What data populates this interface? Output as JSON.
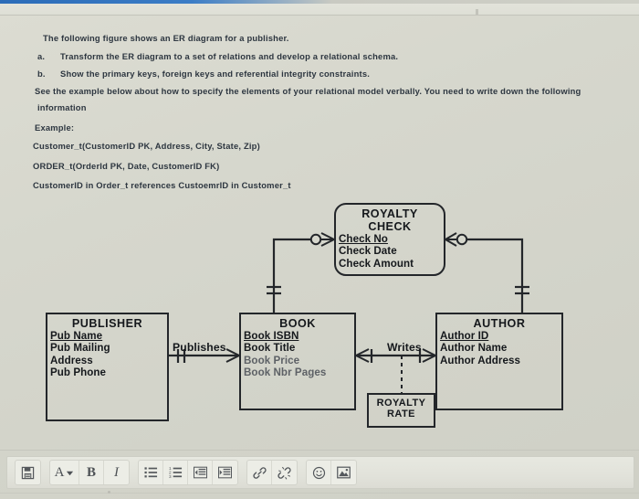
{
  "document": {
    "intro": "The following figure shows an ER diagram for a publisher.",
    "item_a_marker": "a.",
    "item_a_text": "Transform the ER diagram to a set of relations and develop a relational schema.",
    "item_b_marker": "b.",
    "item_b_text": "Show the primary keys, foreign keys and referential integrity constraints.",
    "see_example_line": "See the example below about how to specify the elements of your relational model verbally. You need to write down the following",
    "information_line": "information",
    "example_label": "Example:",
    "example_customer": "Customer_t(CustomerID PK, Address, City, State, Zip)",
    "example_order": "ORDER_t(OrderId PK, Date, CustomerID FK)",
    "example_reference": "CustomerID in Order_t references CustoemrID in Customer_t"
  },
  "diagram": {
    "entities": {
      "royalty_check": {
        "title_line1": "ROYALTY",
        "title_line2": "CHECK",
        "attributes": [
          {
            "label": "Check No",
            "pk": true
          },
          {
            "label": "Check Date",
            "pk": false
          },
          {
            "label": "Check Amount",
            "pk": false
          }
        ]
      },
      "publisher": {
        "title": "PUBLISHER",
        "attributes": [
          {
            "label": "Pub Name",
            "pk": true
          },
          {
            "label": "Pub Mailing",
            "pk": false
          },
          {
            "label": "Address",
            "pk": false
          },
          {
            "label": "Pub Phone",
            "pk": false
          }
        ]
      },
      "book": {
        "title": "BOOK",
        "attributes": [
          {
            "label": "Book ISBN",
            "pk": true
          },
          {
            "label": "Book Title",
            "pk": false
          },
          {
            "label": "Book Price",
            "pk": false
          },
          {
            "label": "Book Nbr Pages",
            "pk": false
          }
        ]
      },
      "author": {
        "title": "AUTHOR",
        "attributes": [
          {
            "label": "Author ID",
            "pk": true
          },
          {
            "label": "Author Name",
            "pk": false
          },
          {
            "label": "Author Address",
            "pk": false
          }
        ]
      },
      "royalty_rate": {
        "title_line1": "ROYALTY",
        "title_line2": "RATE"
      }
    },
    "relationships": {
      "publishes_label": "Publishes",
      "writes_label": "Writes"
    },
    "colors": {
      "line": "#23262a",
      "text": "#15181c",
      "faint_attribute": "#5d6166",
      "canvas": "#d6d7cd"
    }
  },
  "toolbar": {
    "groups": [
      {
        "buttons": [
          {
            "name": "source-code-icon",
            "glyph": "save"
          }
        ]
      },
      {
        "buttons": [
          {
            "name": "font-color-icon",
            "glyph": "A-dropdown",
            "label": "A"
          },
          {
            "name": "bold-button",
            "glyph": "B",
            "label": "B"
          },
          {
            "name": "italic-button",
            "glyph": "I",
            "label": "I"
          }
        ]
      },
      {
        "buttons": [
          {
            "name": "bulleted-list-icon",
            "glyph": "ul"
          },
          {
            "name": "numbered-list-icon",
            "glyph": "ol"
          },
          {
            "name": "outdent-icon",
            "glyph": "outdent"
          },
          {
            "name": "indent-icon",
            "glyph": "indent"
          }
        ]
      },
      {
        "buttons": [
          {
            "name": "insert-link-icon",
            "glyph": "link"
          },
          {
            "name": "unlink-icon",
            "glyph": "unlink"
          }
        ]
      },
      {
        "buttons": [
          {
            "name": "emoji-icon",
            "glyph": "smiley"
          },
          {
            "name": "insert-image-icon",
            "glyph": "image"
          }
        ]
      }
    ]
  }
}
